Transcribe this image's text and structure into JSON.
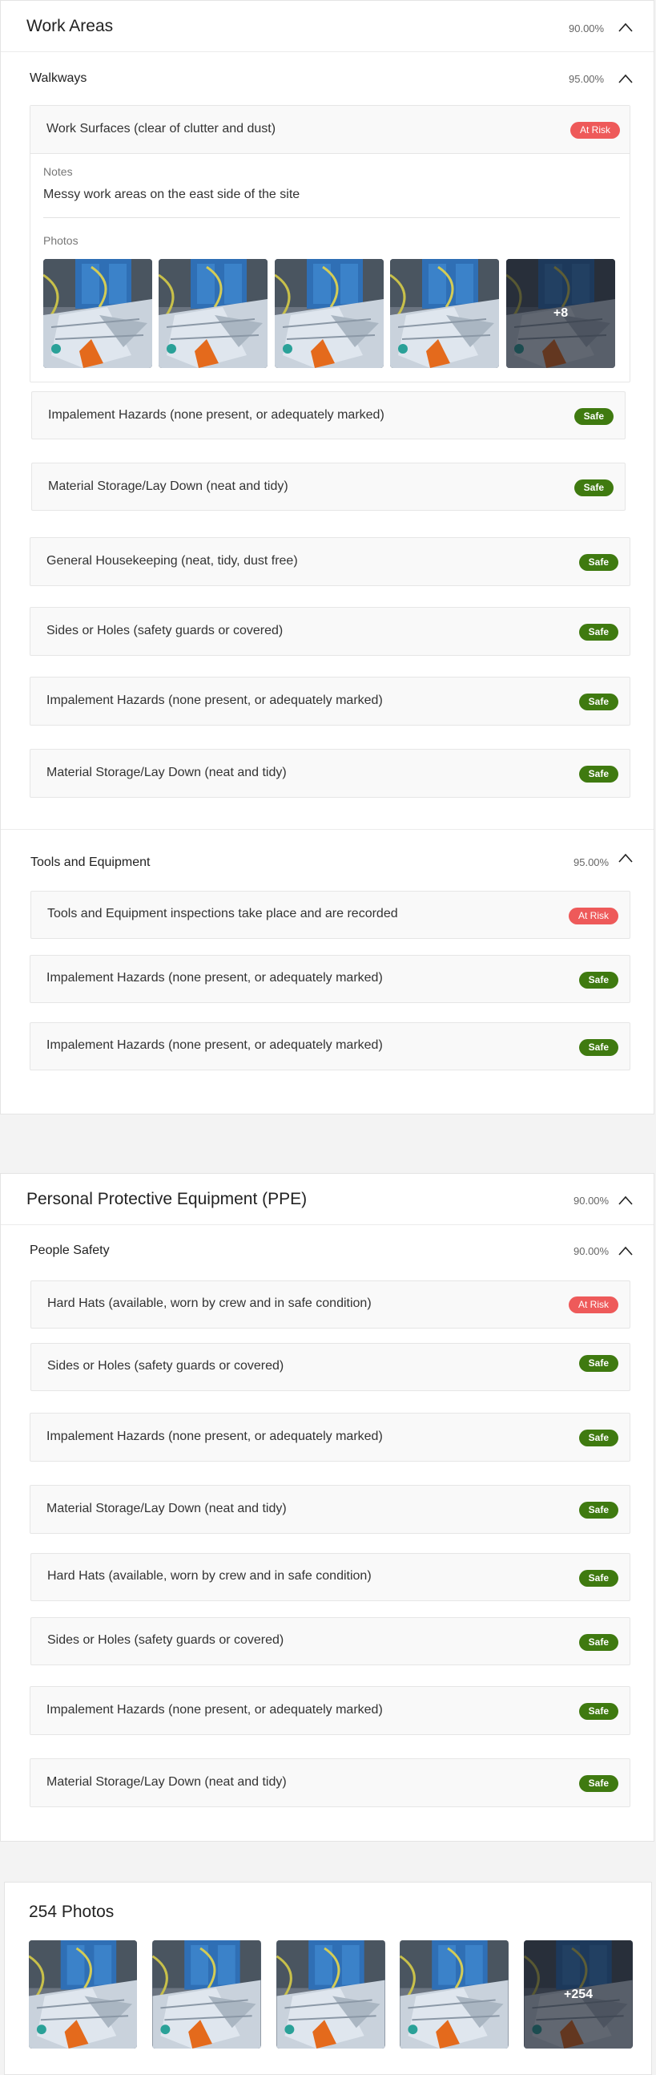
{
  "work_areas": {
    "title": "Work Areas",
    "percent": "90.00%",
    "walkways": {
      "title": "Walkways",
      "percent": "95.00%",
      "expanded_item": {
        "label": "Work Surfaces (clear of clutter and dust)",
        "status": "At Risk",
        "notes_label": "Notes",
        "notes_text": "Messy work areas on the east side of the site",
        "photos_label": "Photos",
        "more_photos": "+8"
      },
      "items": [
        {
          "label": "Impalement Hazards (none present, or adequately marked)",
          "status": "Safe"
        },
        {
          "label": "Material Storage/Lay Down (neat and tidy)",
          "status": "Safe"
        },
        {
          "label": "General Housekeeping (neat, tidy, dust free)",
          "status": "Safe"
        },
        {
          "label": "Sides or Holes (safety guards or covered)",
          "status": "Safe"
        },
        {
          "label": "Impalement Hazards (none present, or adequately marked)",
          "status": "Safe"
        },
        {
          "label": "Material Storage/Lay Down (neat and tidy)",
          "status": "Safe"
        }
      ]
    },
    "tools": {
      "title": "Tools and Equipment",
      "percent": "95.00%",
      "items": [
        {
          "label": "Tools and Equipment inspections take place and are recorded",
          "status": "At Risk"
        },
        {
          "label": "Impalement Hazards (none present, or adequately marked)",
          "status": "Safe"
        },
        {
          "label": "Impalement Hazards (none present, or adequately marked)",
          "status": "Safe"
        }
      ]
    }
  },
  "ppe": {
    "title": "Personal Protective Equipment (PPE)",
    "percent": "90.00%",
    "people_safety": {
      "title": "People Safety",
      "percent": "90.00%",
      "items": [
        {
          "label": "Hard Hats (available, worn by crew and in safe condition)",
          "status": "At Risk"
        },
        {
          "label": "Sides or Holes (safety guards or covered)",
          "status": "Safe"
        },
        {
          "label": "Impalement Hazards (none present, or adequately marked)",
          "status": "Safe"
        },
        {
          "label": "Material Storage/Lay Down (neat and tidy)",
          "status": "Safe"
        },
        {
          "label": "Hard Hats (available, worn by crew and in safe condition)",
          "status": "Safe"
        },
        {
          "label": "Sides or Holes (safety guards or covered)",
          "status": "Safe"
        },
        {
          "label": "Impalement Hazards (none present, or adequately marked)",
          "status": "Safe"
        },
        {
          "label": "Material Storage/Lay Down (neat and tidy)",
          "status": "Safe"
        }
      ]
    }
  },
  "gallery": {
    "title": "254 Photos",
    "more_photos": "+254"
  },
  "icons": {
    "collapse": "chevron-up-icon"
  },
  "colors": {
    "safe": "#3f7a10",
    "at_risk": "#ee5a5a"
  }
}
